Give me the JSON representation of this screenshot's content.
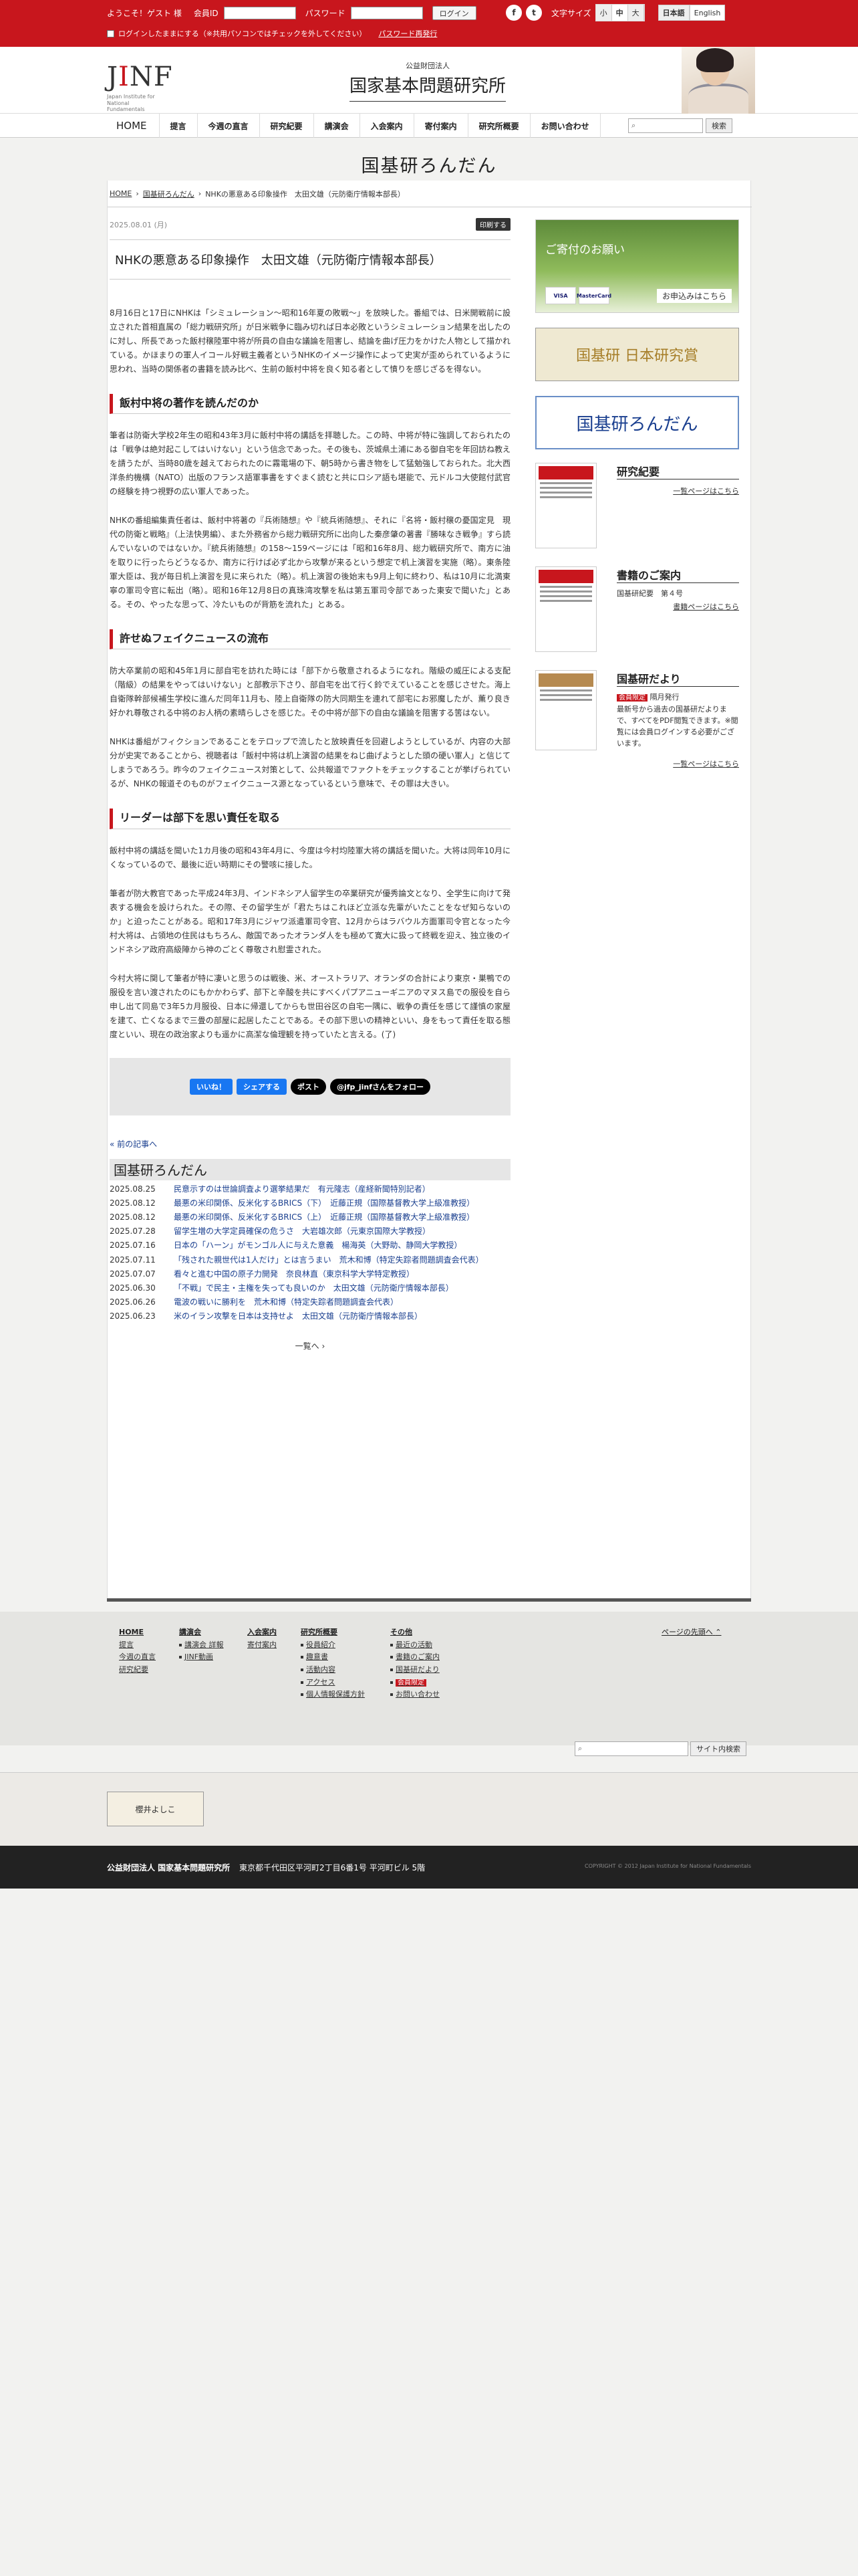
{
  "topbar": {
    "welcome": "ようこそ！ゲスト 様",
    "member_label": "会員ID",
    "password_label": "パスワード",
    "login_button": "ログイン",
    "keep_login": "ログインしたままにする（※共用パソコンではチェックを外してください）",
    "password_reset": "パスワード再発行",
    "font_size_label": "文字サイズ",
    "font_sizes": [
      "小",
      "中",
      "大"
    ],
    "languages": [
      "日本語",
      "English"
    ]
  },
  "header": {
    "logo": "JINF",
    "logo_sub": "Japan Institute for National Fundamentals",
    "corp_type": "公益財団法人",
    "site_name": "国家基本問題研究所"
  },
  "nav": {
    "items": [
      "HOME",
      "提言",
      "今週の直言",
      "研究紀要",
      "講演会",
      "入会案内",
      "寄付案内",
      "研究所概要",
      "お問い合わせ"
    ],
    "search_button": "検索"
  },
  "page": {
    "title": "国基研ろんだん"
  },
  "breadcrumb": [
    "HOME",
    "国基研ろんだん",
    "NHKの悪意ある印象操作　太田文雄（元防衛庁情報本部長）"
  ],
  "article": {
    "date": "2025.08.01 (月)",
    "print": "印刷する",
    "title": "NHKの悪意ある印象操作　太田文雄（元防衛庁情報本部長）",
    "p1": "8月16日と17日にNHKは「シミュレーション〜昭和16年夏の敗戦〜」を放映した。番組では、日米開戦前に設立された首相直属の「総力戦研究所」が日米戦争に臨み切れば日本必敗というシミュレーション結果を出したのに対し、所長であった飯村穣陸軍中将が所員の自由な議論を阻害し、結論を曲げ圧力をかけた人物として描かれている。かほまりの軍人イコール好戦主義者というNHKのイメージ操作によって史実が歪められているように思われ、当時の関係者の書籍を読み比べ、生前の飯村中将を良く知る者として憤りを感じざるを得ない。",
    "h1": "飯村中将の著作を読んだのか",
    "p2": "筆者は防衛大学校2年生の昭和43年3月に飯村中将の講話を拝聴した。この時、中将が特に強調しておられたのは「戦争は絶対起こしてはいけない」という信念であった。その後も、茨城県土浦にある御自宅を年回訪ね教えを請うたが、当時80歳を越えておられたのに霧電場の下、朝5時から書き物をして猛勉強しておられた。北大西洋条約機構（NATO）出版のフランス語軍事書をすぐまく読むと共にロシア語も堪能で、元ドルコ大使館付武官の経験を持つ視野の広い軍人であった。",
    "p3": "NHKの番組編集責任者は、飯村中将著の『兵術随想』や『統兵術随想』、それに『名将・飯村穣の憂国定見　現代の防衛と戦略』（上法快男編）、また外務省から総力戦研究所に出向した秦彦肇の著書『勝味なき戦争』すら読んでいないのではないか。『統兵術随想』の158〜159ページには「昭和16年8月、総力戦研究所で、南方に油を取りに行ったらどうなるか、南方に行けば必ず北から攻撃が来るという想定で机上演習を実施（略）。東条陸軍大臣は、我が毎日机上演習を見に来られた（略）。机上演習の後始末も9月上旬に終わり、私は10月に北満東寧の軍司令官に転出（略）。昭和16年12月8日の真珠湾攻撃を私は第五軍司令部であった東安で聞いた」とある。その、やったな思って、冷たいものが背筋を流れた」とある。",
    "h2": "許せぬフェイクニュースの流布",
    "p4": "防大卒業前の昭和45年1月に部自宅を訪れた時には「部下から敬意されるようになれ。階級の威圧による支配（階級）の結果をやってはいけない」と部教示下さり、部自宅を出て行く鈴でえていることを感じさせた。海上自衛隊幹部候補生学校に進んだ同年11月も、陸上自衛隊の防大同期生を連れて部宅にお邪魔したが、薫り良き好かれ尊敬される中将のお人柄の素晴らしさを感じた。その中将が部下の自由な議論を阻害する筈はない。",
    "p5": "NHKは番組がフィクションであることをテロップで流したと放映責任を回避しようとしているが、内容の大部分が史実であることから、視聴者は「飯村中将は机上演習の結果をねじ曲げようとした頭の硬い軍人」と信じてしまうであろう。昨今のフェイクニュース対策として、公共報道でファクトをチェックすることが挙げられているが、NHKの報道そのものがフェイクニュース源となっているという意味で、その罪は大きい。",
    "h3": "リーダーは部下を思い責任を取る",
    "p6": "飯村中将の講話を聞いた1カ月後の昭和43年4月に、今度は今村均陸軍大将の講話を聞いた。大将は同年10月にくなっているので、最後に近い時期にその警咳に接した。",
    "p7": "筆者が防大教官であった平成24年3月、インドネシア人留学生の卒業研究が優秀論文となり、全学生に向けて発表する機会を設けられた。その際、その留学生が「君たちはこれほど立派な先輩がいたことをなぜ知らないのか」と迫ったことがある。昭和17年3月にジャワ派遣軍司令官、12月からはラバウル方面軍司令官となった今村大将は、占領地の住民はもちろん、敵国であったオランダ人をも極めて寛大に扱って終戦を迎え、独立後のインドネシア政府高級陣から神のごとく尊敬され慰霊された。",
    "p8": "今村大将に関して筆者が特に凄いと思うのは戦後、米、オーストラリア、オランダの合計により東京・巣鴨での服役を言い渡されたのにもかかわらず、部下と辛酸を共にすべくパプアニューギニアのマヌス島での服役を自ら申し出て同島で3年5カ月服役、日本に帰還してからも世田谷区の自宅一隅に、戦争の責任を感じて謹慎の家屋を建て、亡くなるまで三畳の部屋に起居したことである。その部下思いの精神といい、身をもって責任を取る態度といい、現在の政治家よりも遥かに高潔な倫理観を持っていたと言える。(了)",
    "share": [
      "いいね！",
      "シェアする",
      "ポスト",
      "@jfp_jinfさんをフォロー"
    ],
    "back": "« 前の記事へ"
  },
  "related": {
    "title": "国基研ろんだん",
    "items": [
      {
        "date": "2025.08.25",
        "title": "民意示すのは世論調査より選挙結果だ　有元隆志（産経新聞特別記者）"
      },
      {
        "date": "2025.08.12",
        "title": "最悪の米印関係、反米化するBRICS（下）　近藤正規（国際基督教大学上級准教授）"
      },
      {
        "date": "2025.08.12",
        "title": "最悪の米印関係、反米化するBRICS（上）　近藤正規（国際基督教大学上級准教授）"
      },
      {
        "date": "2025.07.28",
        "title": "留学生増の大学定員確保の危うさ　大岩雄次郎（元東京国際大学教授）"
      },
      {
        "date": "2025.07.16",
        "title": "日本の「ハーン」がモンゴル人に与えた意義　楊海英（大野助、静岡大学教授）"
      },
      {
        "date": "2025.07.11",
        "title": "「残された親世代は1人だけ」とは言うまい　荒木和博（特定失踪者問題調査会代表）"
      },
      {
        "date": "2025.07.07",
        "title": "看々と進む中国の原子力開発　奈良林直（東京科学大学特定教授）"
      },
      {
        "date": "2025.06.30",
        "title": "「不戦」で民主・主権を失っても良いのか　太田文雄（元防衛庁情報本部長）"
      },
      {
        "date": "2025.06.26",
        "title": "電波の戦いに勝利を　荒木和博（特定失踪者問題調査会代表）"
      },
      {
        "date": "2025.06.23",
        "title": "米のイラン攻撃を日本は支持せよ　太田文雄（元防衛庁情報本部長）"
      }
    ],
    "more": "一覧へ"
  },
  "sidebar": {
    "donate_msg": "ご寄付のお願い",
    "donate_go": "お申込みはこちら",
    "card_brands": [
      "VISA",
      "MasterCard"
    ],
    "banner1": "国基研 日本研究賞",
    "banner2": "国基研ろんだん",
    "kiyou_title": "研究紀要",
    "kiyou_link": "一覧ページはこちら",
    "shoseki_title": "書籍のご案内",
    "shoseki_text": "国基研紀要　第４号",
    "shoseki_link": "書籍ページはこちら",
    "dayori_title": "国基研だより",
    "dayori_tag": "会員限定",
    "dayori_text": "隔月発行\n最新号から過去の国基研だよりまで、すべてをPDF閲覧できます。※閲覧には会員ログインする必要がございます。",
    "dayori_link": "一覧ページはこちら"
  },
  "footer": {
    "pagetop": "ページの先頭へ",
    "cols": [
      {
        "head": "HOME",
        "items": [
          "提言",
          "今週の直言",
          "研究紀要"
        ]
      },
      {
        "head": "講演会",
        "items": [
          "講演会 詳報",
          "JINF動画"
        ]
      },
      {
        "head": "入会案内",
        "items": [
          "寄付案内"
        ]
      },
      {
        "head": "研究所概要",
        "items": [
          "役員紹介",
          "趣意書",
          "活動内容",
          "アクセス",
          "個人情報保護方針"
        ]
      },
      {
        "head": "その他",
        "items": [
          "最近の活動",
          "書籍のご案内",
          "国基研だより",
          "会員限定",
          "お問い合わせ"
        ]
      }
    ],
    "search_button": "サイト内検索",
    "banner": "櫻井よしこ",
    "org": "公益財団法人 国家基本問題研究所",
    "address": "東京都千代田区平河町2丁目6番1号 平河町ビル 5階",
    "copyright": "COPYRIGHT © 2012 Japan Institute for National Fundamentals"
  }
}
